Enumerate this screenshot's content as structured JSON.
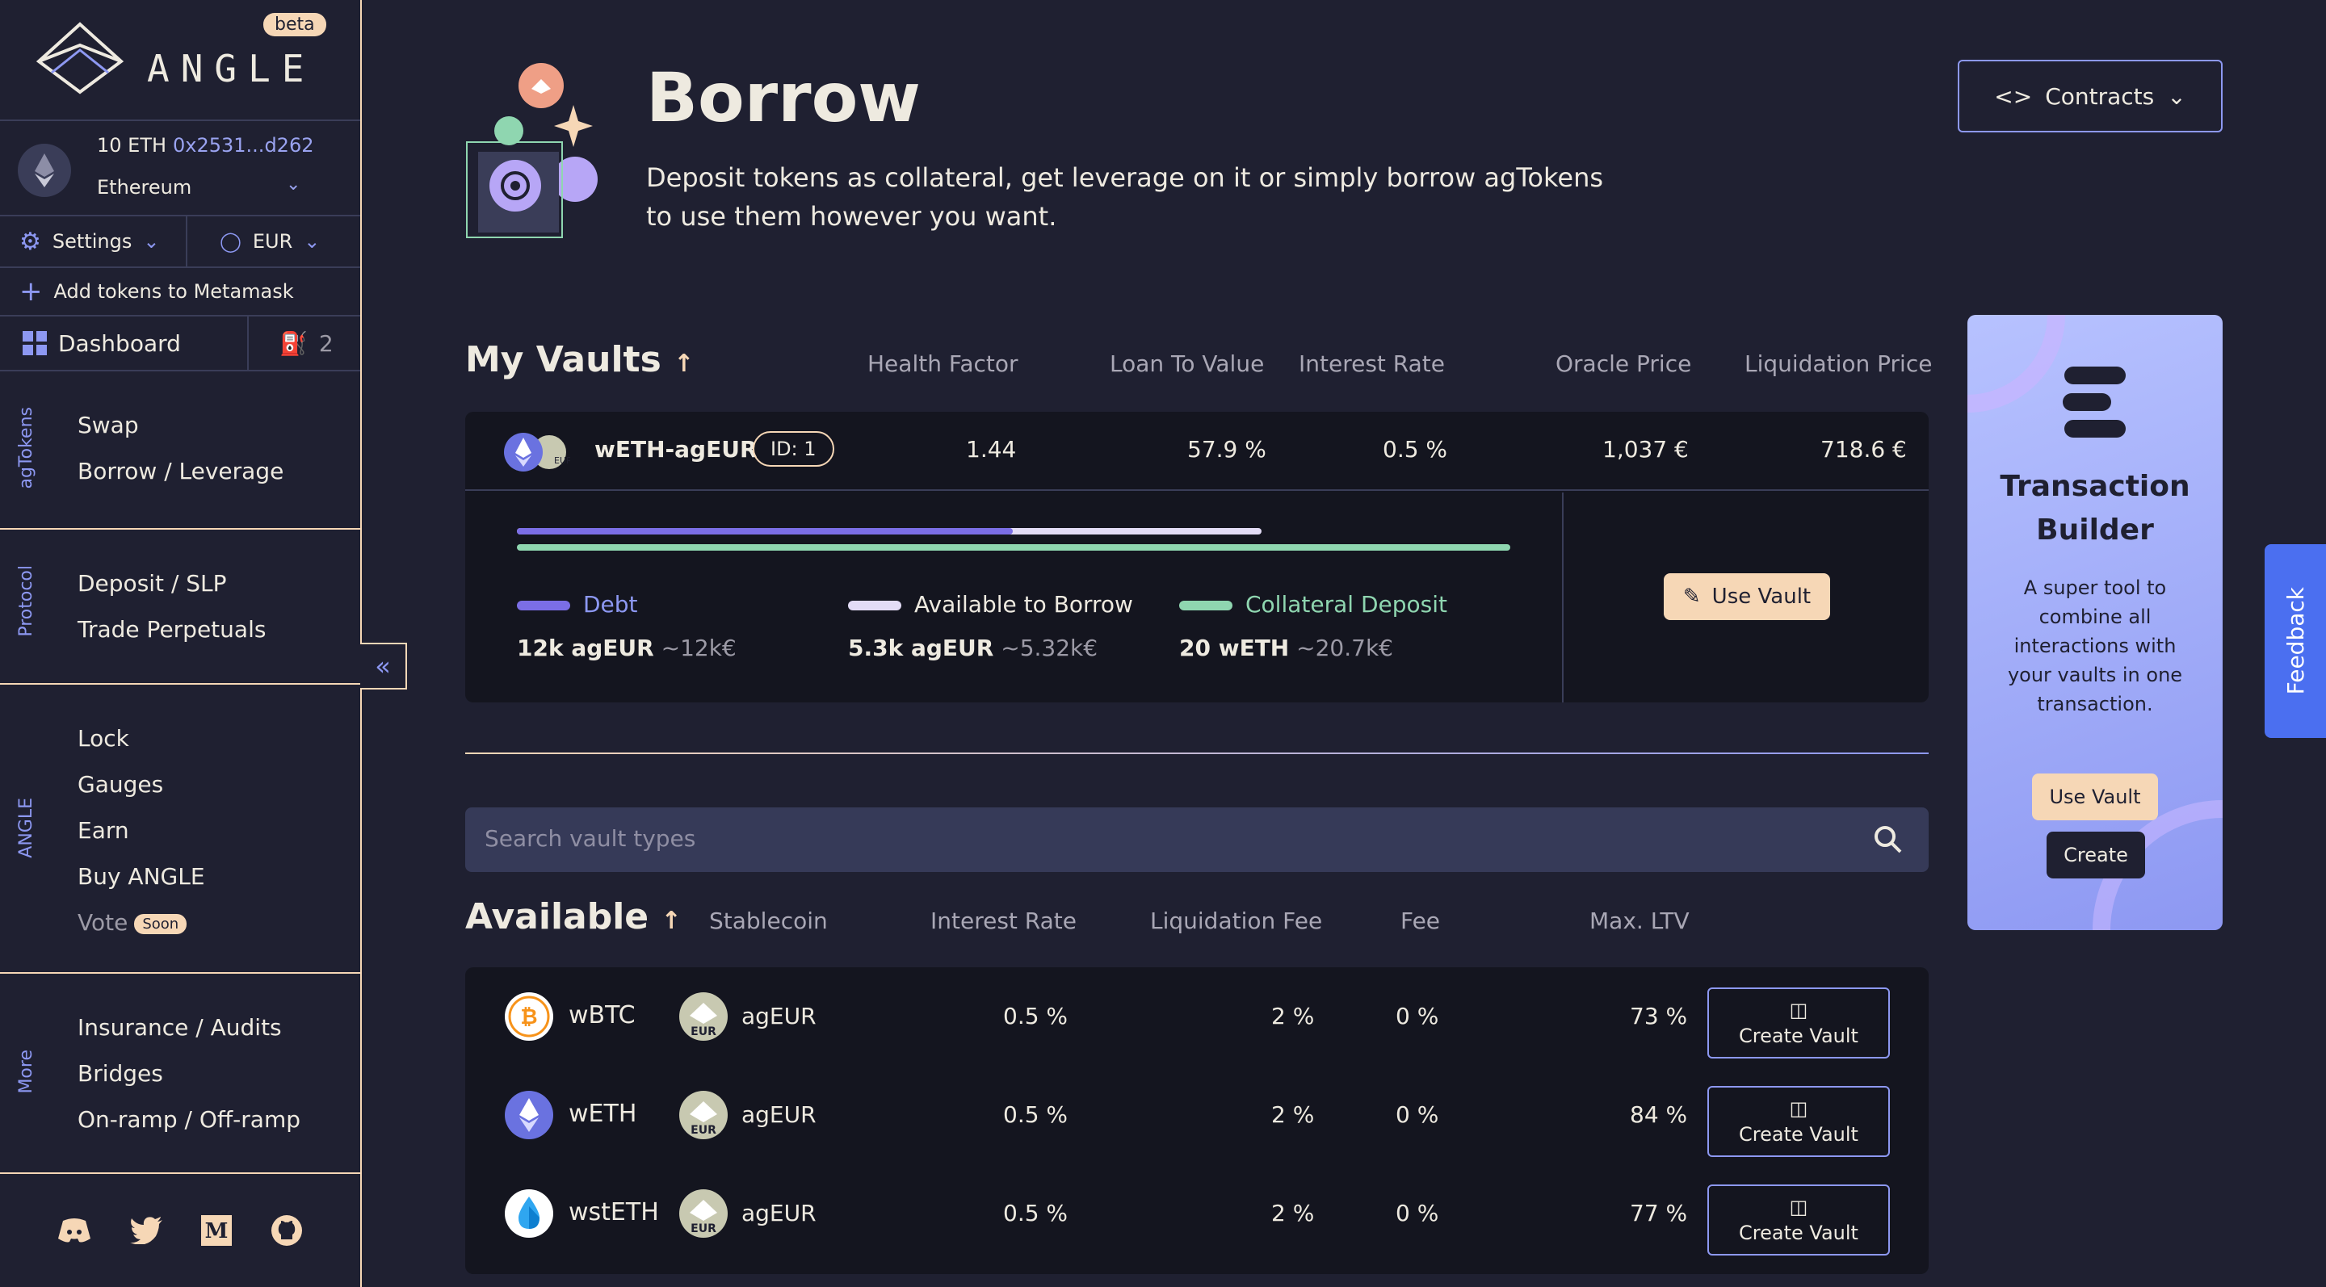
{
  "sidebar": {
    "beta": "beta",
    "brand": "ANGLE",
    "wallet": {
      "balance": "10 ETH",
      "address": "0x2531...d262",
      "network": "Ethereum"
    },
    "settings": "Settings",
    "currency": "EUR",
    "add_tokens": "Add tokens to Metamask",
    "dashboard": "Dashboard",
    "dashboard_count": "2",
    "sections": [
      {
        "label": "agTokens",
        "items": [
          "Swap",
          "Borrow / Leverage"
        ]
      },
      {
        "label": "Protocol",
        "items": [
          "Deposit / SLP",
          "Trade Perpetuals"
        ]
      },
      {
        "label": "ANGLE",
        "items": [
          "Lock",
          "Gauges",
          "Earn",
          "Buy ANGLE",
          "Vote"
        ],
        "soon": "Soon"
      },
      {
        "label": "More",
        "items": [
          "Insurance / Audits",
          "Bridges",
          "On-ramp / Off-ramp"
        ]
      }
    ],
    "colors": {
      "accent": "#8d98f2",
      "peach": "#f6d7b6"
    }
  },
  "header": {
    "title": "Borrow",
    "subtitle": "Deposit tokens as collateral, get leverage on it or simply borrow agTokens to use them however you want.",
    "contracts": "Contracts"
  },
  "my_vaults": {
    "title": "My Vaults",
    "columns": [
      "Health Factor",
      "Loan To Value",
      "Interest Rate",
      "Oracle Price",
      "Liquidation Price"
    ],
    "vault": {
      "name": "wETH-agEUR",
      "id": "ID: 1",
      "health_factor": "1.44",
      "ltv": "57.9 %",
      "interest_rate": "0.5 %",
      "oracle_price": "1,037 €",
      "liquidation_price": "718.6 €",
      "debt_label": "Debt",
      "debt_amount": "12k agEUR",
      "debt_fiat": "~12k€",
      "available_label": "Available to Borrow",
      "available_amount": "5.3k agEUR",
      "available_fiat": "~5.32k€",
      "collateral_label": "Collateral Deposit",
      "collateral_amount": "20 wETH",
      "collateral_fiat": "~20.7k€",
      "debt_fraction": 0.58,
      "available_fraction": 0.25,
      "use_vault": "Use Vault"
    }
  },
  "search": {
    "placeholder": "Search vault types"
  },
  "available": {
    "title": "Available",
    "columns": [
      "Stablecoin",
      "Interest Rate",
      "Liquidation Fee",
      "Fee",
      "Max. LTV"
    ],
    "rows": [
      {
        "asset": "wBTC",
        "stable": "agEUR",
        "rate": "0.5 %",
        "liq_fee": "2 %",
        "fee": "0 %",
        "max_ltv": "73 %",
        "action": "Create Vault"
      },
      {
        "asset": "wETH",
        "stable": "agEUR",
        "rate": "0.5 %",
        "liq_fee": "2 %",
        "fee": "0 %",
        "max_ltv": "84 %",
        "action": "Create Vault"
      },
      {
        "asset": "wstETH",
        "stable": "agEUR",
        "rate": "0.5 %",
        "liq_fee": "2 %",
        "fee": "0 %",
        "max_ltv": "77 %",
        "action": "Create Vault"
      }
    ]
  },
  "builder": {
    "title": "Transaction Builder",
    "desc": "A super tool to combine all interactions with your vaults in one transaction.",
    "use_vault": "Use Vault",
    "create": "Create"
  },
  "feedback": "Feedback",
  "icons": {
    "eur_badge": "EUR"
  }
}
